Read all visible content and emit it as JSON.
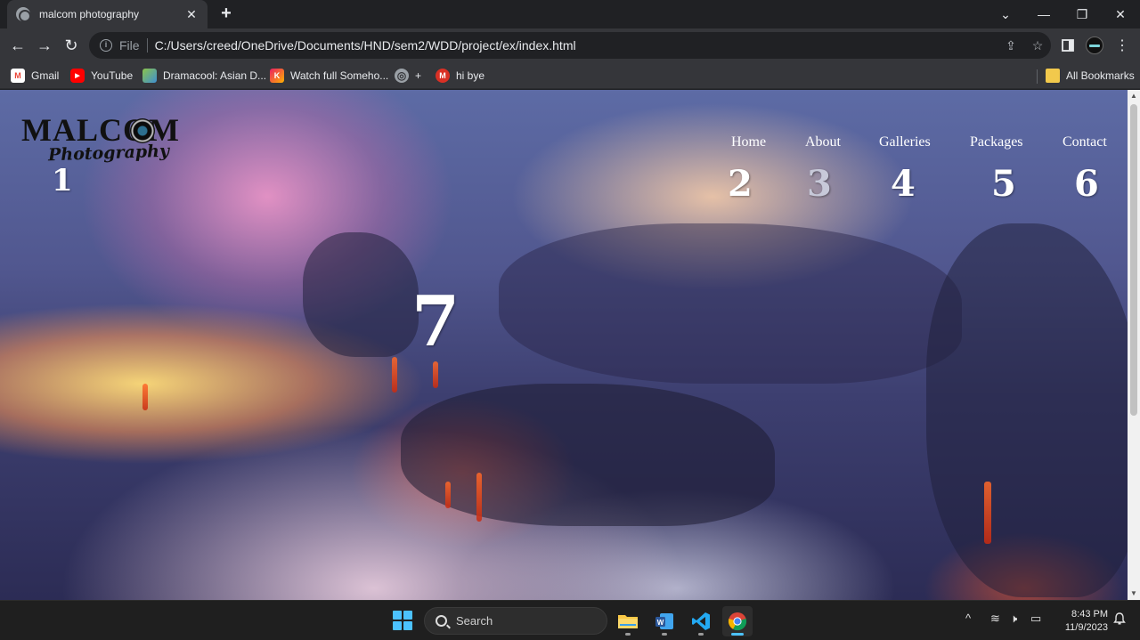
{
  "browser": {
    "tab": {
      "title": "malcom photography",
      "close": "✕"
    },
    "new_tab": "+",
    "window_controls": {
      "dropdown": "⌄",
      "minimize": "—",
      "restore": "❐",
      "close": "✕"
    },
    "nav": {
      "back": "←",
      "forward": "→",
      "reload": "↻"
    },
    "omnibox": {
      "scheme_label": "File",
      "url": "C:/Users/creed/OneDrive/Documents/HND/sem2/WDD/project/ex/index.html"
    },
    "bookmarks": [
      {
        "label": "Gmail",
        "icon": "gmail-icon",
        "color": "#ea4335",
        "glyph": "M"
      },
      {
        "label": "YouTube",
        "icon": "youtube-icon",
        "color": "#ff0000",
        "glyph": "▶"
      },
      {
        "label": "Dramacool: Asian D...",
        "icon": "dramacool-icon",
        "color": "#8bc34a",
        "glyph": ""
      },
      {
        "label": "Watch full Someho...",
        "icon": "watch-icon",
        "color": "#e91e63",
        "glyph": "K"
      },
      {
        "label": "+",
        "icon": "globe-icon",
        "color": "#9aa0a6",
        "glyph": "◎"
      },
      {
        "label": "hi bye",
        "icon": "mail-m-icon",
        "color": "#d93025",
        "glyph": "M"
      }
    ],
    "all_bookmarks": "All Bookmarks"
  },
  "page": {
    "logo": {
      "main": "MALCOM",
      "sub": "Photography"
    },
    "nav_items": [
      "Home",
      "About",
      "Galleries",
      "Packages",
      "Contact"
    ],
    "markers": [
      "1",
      "2",
      "3",
      "4",
      "5",
      "6",
      "7"
    ]
  },
  "taskbar": {
    "search_label": "Search",
    "time": "8:43 PM",
    "date": "11/9/2023",
    "tray": {
      "chevron": "^",
      "wifi": "≋",
      "volume": "🕨",
      "battery": "▭"
    }
  },
  "colors": {
    "tab_bg": "#35363a",
    "frame_bg": "#202124",
    "start_blue": "#4cc2ff",
    "vscode_blue": "#23a9f2",
    "word_blue": "#2b579a"
  }
}
